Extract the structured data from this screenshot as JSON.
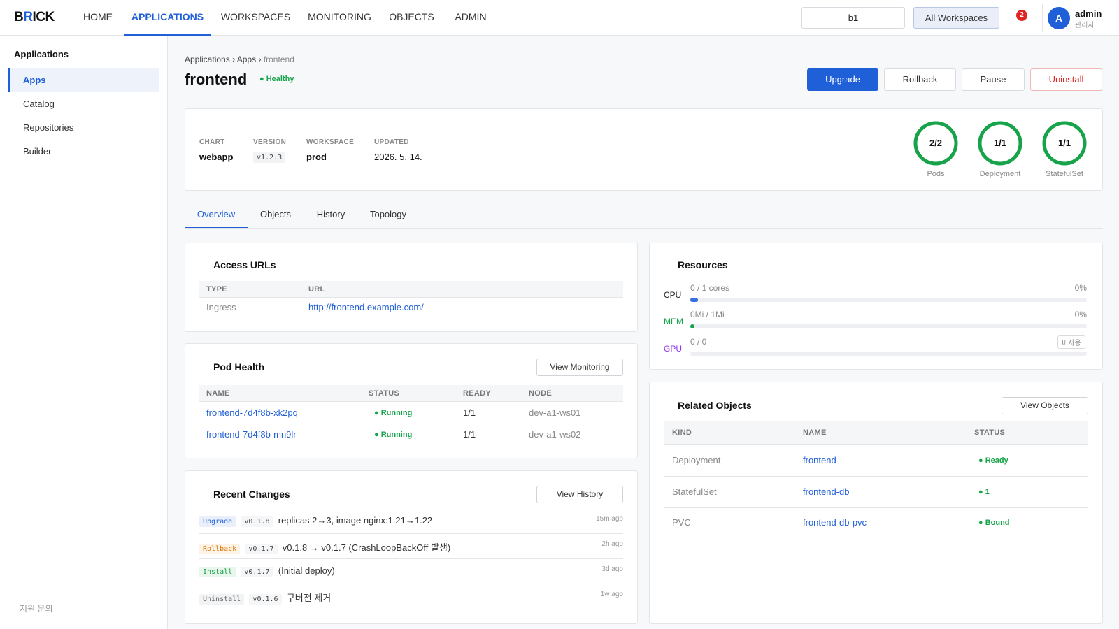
{
  "brand": {
    "logo_prefix": "B",
    "logo_accent": "R",
    "logo_suffix": "ICK"
  },
  "topnav": {
    "items": [
      "HOME",
      "APPLICATIONS",
      "WORKSPACES",
      "MONITORING",
      "OBJECTS",
      "ADMIN"
    ],
    "active": "APPLICATIONS",
    "workspace_input_value": "b1",
    "workspace_button": "All Workspaces",
    "notification_count": "2",
    "user_initial": "A",
    "user_name": "admin",
    "user_role": "관리자"
  },
  "sidebar": {
    "title": "Applications",
    "items": [
      "Apps",
      "Catalog",
      "Repositories",
      "Builder"
    ],
    "active": "Apps",
    "support": "지원 문의"
  },
  "breadcrumb": {
    "items": [
      "Applications",
      "Apps",
      "frontend"
    ],
    "separator": "›"
  },
  "app": {
    "name": "frontend",
    "health": "● Healthy",
    "actions": {
      "upgrade": "Upgrade",
      "rollback": "Rollback",
      "pause": "Pause",
      "uninstall": "Uninstall"
    },
    "meta": {
      "chart_label": "CHART",
      "chart": "webapp",
      "version_label": "VERSION",
      "version": "v1.2.3",
      "workspace_label": "WORKSPACE",
      "workspace": "prod",
      "updated_label": "UPDATED",
      "updated": "2026. 5. 14."
    },
    "rings": [
      {
        "value": "2/2",
        "label": "Pods",
        "ratio": 1.0
      },
      {
        "value": "1/1",
        "label": "Deployment",
        "ratio": 1.0
      },
      {
        "value": "1/1",
        "label": "StatefulSet",
        "ratio": 1.0
      }
    ]
  },
  "tabs": {
    "items": [
      "Overview",
      "Objects",
      "History",
      "Topology"
    ],
    "active": "Overview"
  },
  "access_urls": {
    "title": "Access URLs",
    "columns": [
      "TYPE",
      "URL"
    ],
    "rows": [
      {
        "type": "Ingress",
        "url": "http://frontend.example.com/"
      }
    ]
  },
  "pod_health": {
    "title": "Pod Health",
    "button": "View Monitoring",
    "columns": [
      "NAME",
      "STATUS",
      "READY",
      "NODE"
    ],
    "rows": [
      {
        "name": "frontend-7d4f8b-xk2pq",
        "status": "● Running",
        "ready": "1/1",
        "node": "dev-a1-ws01"
      },
      {
        "name": "frontend-7d4f8b-mn9lr",
        "status": "● Running",
        "ready": "1/1",
        "node": "dev-a1-ws02"
      }
    ]
  },
  "recent_changes": {
    "title": "Recent Changes",
    "button": "View History",
    "rows": [
      {
        "kind": "Upgrade",
        "kind_style": "upgrade",
        "version": "v0.1.8",
        "desc": "replicas 2→3, image nginx:1.21→1.22",
        "ago": "15m ago"
      },
      {
        "kind": "Rollback",
        "kind_style": "rollback",
        "version": "v0.1.7",
        "desc": "v0.1.8 → v0.1.7 (CrashLoopBackOff 발생)",
        "ago": "2h ago"
      },
      {
        "kind": "Install",
        "kind_style": "install",
        "version": "v0.1.7",
        "desc": "(Initial deploy)",
        "ago": "3d ago"
      },
      {
        "kind": "Uninstall",
        "kind_style": "uninstall",
        "version": "v0.1.6",
        "desc": "구버전 제거",
        "ago": "1w ago"
      }
    ]
  },
  "resources": {
    "title": "Resources",
    "rows": [
      {
        "label": "CPU",
        "color": "#222222",
        "bar_color": "#3b6fe0",
        "value": "0 / 1 cores",
        "pct": "0%",
        "fill": 0.02
      },
      {
        "label": "MEM",
        "color": "#16a34a",
        "bar_color": "#16a34a",
        "value": "0Mi / 1Mi",
        "pct": "0%",
        "fill": 0.01
      },
      {
        "label": "GPU",
        "color": "#9333ea",
        "bar_color": "#9333ea",
        "value": "0 / 0",
        "pct": "",
        "chip": "미사용",
        "fill": 0
      }
    ]
  },
  "related_objects": {
    "title": "Related Objects",
    "button": "View Objects",
    "columns": [
      "KIND",
      "NAME",
      "STATUS"
    ],
    "rows": [
      {
        "kind": "Deployment",
        "name": "frontend",
        "status": "● Ready"
      },
      {
        "kind": "StatefulSet",
        "name": "frontend-db",
        "status": "● 1"
      },
      {
        "kind": "PVC",
        "name": "frontend-db-pvc",
        "status": "● Bound"
      }
    ]
  },
  "colors": {
    "accent": "#1f5fd8",
    "success": "#16a34a",
    "danger": "#dc2626",
    "ring_track": "#e5e7eb"
  }
}
